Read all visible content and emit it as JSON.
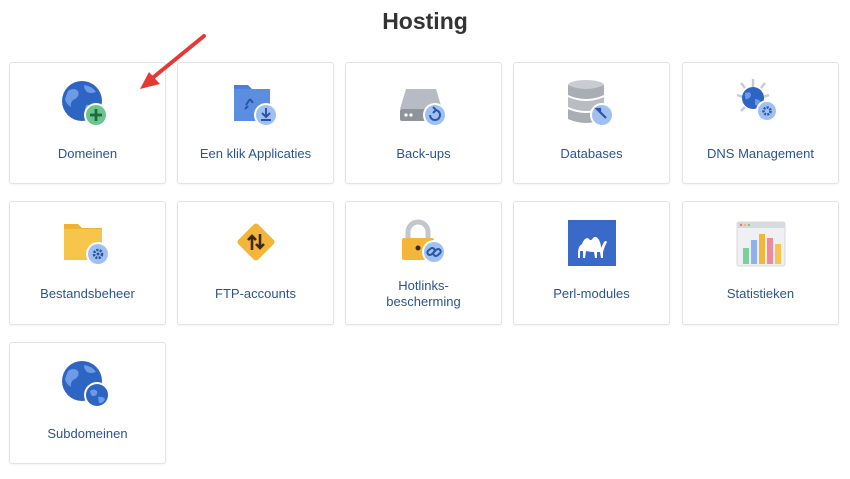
{
  "page": {
    "title": "Hosting"
  },
  "colors": {
    "label": "#2a5491",
    "arrow": "#e53935",
    "title": "#333333"
  },
  "tiles": [
    {
      "id": "domeinen",
      "label": "Domeinen",
      "icon": "globe-plus-icon"
    },
    {
      "id": "een-klik-applicaties",
      "label": "Een klik Applicaties",
      "icon": "folder-download-icon"
    },
    {
      "id": "back-ups",
      "label": "Back-ups",
      "icon": "hard-drive-restore-icon"
    },
    {
      "id": "databases",
      "label": "Databases",
      "icon": "database-icon"
    },
    {
      "id": "dns-management",
      "label": "DNS Management",
      "icon": "globe-gear-icon"
    },
    {
      "id": "bestandsbeheer",
      "label": "Bestandsbeheer",
      "icon": "folder-gear-icon"
    },
    {
      "id": "ftp-accounts",
      "label": "FTP-accounts",
      "icon": "transfer-arrows-icon"
    },
    {
      "id": "hotlinks-bescherming",
      "label": "Hotlinks-bescherming",
      "label_line1": "Hotlinks-",
      "label_line2": "bescherming",
      "icon": "lock-link-icon"
    },
    {
      "id": "perl-modules",
      "label": "Perl-modules",
      "icon": "camel-icon"
    },
    {
      "id": "statistieken",
      "label": "Statistieken",
      "icon": "bar-chart-icon"
    },
    {
      "id": "subdomeinen",
      "label": "Subdomeinen",
      "icon": "globe-subdomain-icon"
    }
  ]
}
